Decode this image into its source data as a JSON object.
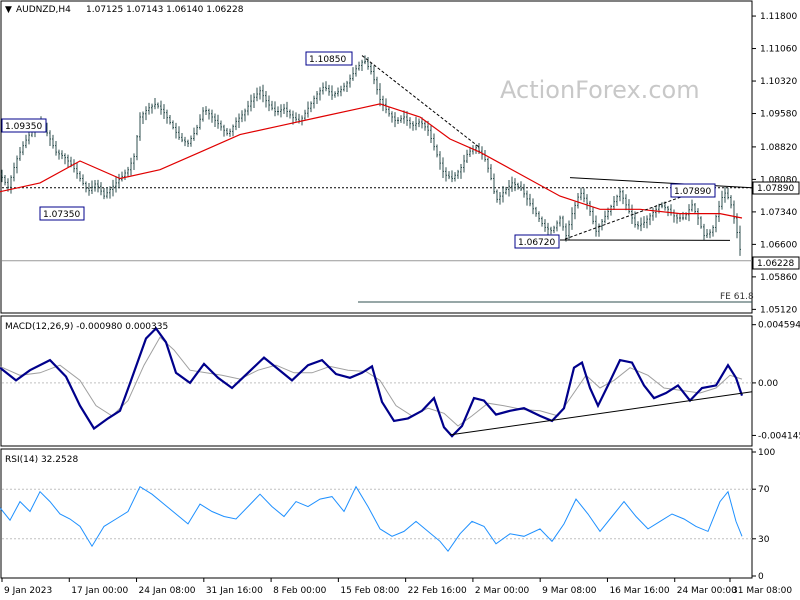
{
  "header": {
    "symbol": "AUDNZD,H4",
    "ohlc": "1.07125 1.07143 1.06140 1.06228"
  },
  "watermark": "ActionForex.com",
  "colors": {
    "candle": "#2f4f4f",
    "ma": "#e00000",
    "macd": "#00008b",
    "signal": "#a0a0a0",
    "rsi": "#1e90ff",
    "trend": "#000000",
    "grid": "#c0c0c0"
  },
  "chart_data": [
    {
      "type": "candlestick",
      "panel": "price",
      "yticks": [
        1.118,
        1.1106,
        1.1032,
        1.0958,
        1.0882,
        1.0808,
        1.0734,
        1.066,
        1.0586,
        1.0512
      ],
      "ylim": [
        1.0506,
        1.1212
      ],
      "current_price": "1.06228",
      "level_label": "1.07890",
      "fib_label": "FE 61.8",
      "annotations": [
        "1.09350",
        "1.07350",
        "1.10850",
        "1.06720",
        "1.07890"
      ],
      "close_path": [
        [
          0,
          1.082
        ],
        [
          8,
          1.079
        ],
        [
          16,
          1.085
        ],
        [
          24,
          1.089
        ],
        [
          32,
          1.092
        ],
        [
          40,
          1.094
        ],
        [
          48,
          1.091
        ],
        [
          56,
          1.087
        ],
        [
          64,
          1.086
        ],
        [
          72,
          1.084
        ],
        [
          80,
          1.081
        ],
        [
          88,
          1.078
        ],
        [
          96,
          1.08
        ],
        [
          104,
          1.077
        ],
        [
          112,
          1.079
        ],
        [
          120,
          1.081
        ],
        [
          128,
          1.083
        ],
        [
          134,
          1.086
        ],
        [
          140,
          1.095
        ],
        [
          148,
          1.097
        ],
        [
          156,
          1.098
        ],
        [
          164,
          1.096
        ],
        [
          172,
          1.093
        ],
        [
          180,
          1.09
        ],
        [
          188,
          1.089
        ],
        [
          196,
          1.092
        ],
        [
          204,
          1.097
        ],
        [
          212,
          1.095
        ],
        [
          220,
          1.093
        ],
        [
          228,
          1.091
        ],
        [
          236,
          1.094
        ],
        [
          244,
          1.096
        ],
        [
          252,
          1.099
        ],
        [
          260,
          1.101
        ],
        [
          268,
          1.098
        ],
        [
          276,
          1.096
        ],
        [
          284,
          1.097
        ],
        [
          292,
          1.095
        ],
        [
          300,
          1.094
        ],
        [
          308,
          1.097
        ],
        [
          316,
          1.1
        ],
        [
          324,
          1.102
        ],
        [
          332,
          1.1
        ],
        [
          340,
          1.101
        ],
        [
          348,
          1.103
        ],
        [
          356,
          1.106
        ],
        [
          364,
          1.108
        ],
        [
          372,
          1.105
        ],
        [
          380,
          1.099
        ],
        [
          388,
          1.096
        ],
        [
          396,
          1.094
        ],
        [
          404,
          1.095
        ],
        [
          412,
          1.093
        ],
        [
          420,
          1.094
        ],
        [
          428,
          1.092
        ],
        [
          436,
          1.087
        ],
        [
          444,
          1.082
        ],
        [
          452,
          1.081
        ],
        [
          460,
          1.083
        ],
        [
          468,
          1.087
        ],
        [
          476,
          1.088
        ],
        [
          484,
          1.086
        ],
        [
          490,
          1.082
        ],
        [
          496,
          1.076
        ],
        [
          504,
          1.078
        ],
        [
          512,
          1.08
        ],
        [
          520,
          1.079
        ],
        [
          528,
          1.076
        ],
        [
          536,
          1.073
        ],
        [
          544,
          1.07
        ],
        [
          552,
          1.069
        ],
        [
          560,
          1.072
        ],
        [
          566,
          1.068
        ],
        [
          572,
          1.073
        ],
        [
          580,
          1.078
        ],
        [
          588,
          1.075
        ],
        [
          596,
          1.069
        ],
        [
          604,
          1.072
        ],
        [
          612,
          1.075
        ],
        [
          620,
          1.078
        ],
        [
          628,
          1.074
        ],
        [
          636,
          1.07
        ],
        [
          644,
          1.071
        ],
        [
          652,
          1.073
        ],
        [
          660,
          1.075
        ],
        [
          668,
          1.074
        ],
        [
          676,
          1.072
        ],
        [
          684,
          1.072
        ],
        [
          692,
          1.075
        ],
        [
          698,
          1.072
        ],
        [
          704,
          1.068
        ],
        [
          712,
          1.069
        ],
        [
          718,
          1.074
        ],
        [
          724,
          1.078
        ],
        [
          730,
          1.076
        ],
        [
          736,
          1.07
        ],
        [
          742,
          1.0623
        ]
      ],
      "ma_path": [
        [
          0,
          1.078
        ],
        [
          40,
          1.08
        ],
        [
          80,
          1.085
        ],
        [
          120,
          1.081
        ],
        [
          160,
          1.083
        ],
        [
          200,
          1.087
        ],
        [
          240,
          1.091
        ],
        [
          280,
          1.093
        ],
        [
          320,
          1.095
        ],
        [
          360,
          1.097
        ],
        [
          380,
          1.098
        ],
        [
          420,
          1.095
        ],
        [
          450,
          1.09
        ],
        [
          480,
          1.087
        ],
        [
          520,
          1.082
        ],
        [
          560,
          1.077
        ],
        [
          600,
          1.074
        ],
        [
          640,
          1.074
        ],
        [
          680,
          1.073
        ],
        [
          720,
          1.073
        ],
        [
          742,
          1.072
        ]
      ]
    },
    {
      "type": "line",
      "panel": "macd",
      "title": "MACD(12,26,9) -0.000980 0.000335",
      "yticks": [
        0.004594,
        0.0,
        -0.004145
      ],
      "ylim": [
        -0.0049,
        0.0052
      ],
      "series": [
        {
          "name": "MACD",
          "points": [
            [
              0,
              0.0012
            ],
            [
              16,
              0.0002
            ],
            [
              30,
              0.001
            ],
            [
              50,
              0.0018
            ],
            [
              66,
              0.0005
            ],
            [
              80,
              -0.0018
            ],
            [
              94,
              -0.0036
            ],
            [
              108,
              -0.0028
            ],
            [
              120,
              -0.0022
            ],
            [
              132,
              0.0004
            ],
            [
              146,
              0.0035
            ],
            [
              156,
              0.0043
            ],
            [
              166,
              0.0032
            ],
            [
              176,
              0.0008
            ],
            [
              190,
              0.0
            ],
            [
              204,
              0.0015
            ],
            [
              218,
              0.0004
            ],
            [
              232,
              -0.0004
            ],
            [
              248,
              0.0008
            ],
            [
              264,
              0.002
            ],
            [
              278,
              0.0011
            ],
            [
              292,
              0.0002
            ],
            [
              308,
              0.0014
            ],
            [
              322,
              0.0018
            ],
            [
              336,
              0.0007
            ],
            [
              350,
              0.0004
            ],
            [
              362,
              0.0008
            ],
            [
              372,
              0.0013
            ],
            [
              382,
              -0.0015
            ],
            [
              394,
              -0.003
            ],
            [
              408,
              -0.0028
            ],
            [
              422,
              -0.0022
            ],
            [
              434,
              -0.0012
            ],
            [
              444,
              -0.0035
            ],
            [
              452,
              -0.0042
            ],
            [
              462,
              -0.0034
            ],
            [
              474,
              -0.0012
            ],
            [
              484,
              -0.0014
            ],
            [
              496,
              -0.0025
            ],
            [
              510,
              -0.0022
            ],
            [
              524,
              -0.002
            ],
            [
              540,
              -0.0026
            ],
            [
              552,
              -0.003
            ],
            [
              564,
              -0.002
            ],
            [
              574,
              0.0012
            ],
            [
              582,
              0.0016
            ],
            [
              590,
              -0.0004
            ],
            [
              598,
              -0.0018
            ],
            [
              608,
              -0.0002
            ],
            [
              620,
              0.0018
            ],
            [
              632,
              0.0016
            ],
            [
              644,
              -0.0002
            ],
            [
              654,
              -0.0012
            ],
            [
              666,
              -0.0008
            ],
            [
              678,
              -0.0002
            ],
            [
              690,
              -0.0014
            ],
            [
              702,
              -0.0004
            ],
            [
              716,
              -0.0002
            ],
            [
              728,
              0.0014
            ],
            [
              736,
              0.0004
            ],
            [
              742,
              -0.001
            ]
          ]
        },
        {
          "name": "Signal",
          "points": [
            [
              0,
              0.0013
            ],
            [
              20,
              0.0006
            ],
            [
              40,
              0.0008
            ],
            [
              60,
              0.0014
            ],
            [
              80,
              0.0002
            ],
            [
              96,
              -0.0018
            ],
            [
              112,
              -0.0026
            ],
            [
              128,
              -0.0014
            ],
            [
              144,
              0.0014
            ],
            [
              160,
              0.0036
            ],
            [
              174,
              0.0026
            ],
            [
              190,
              0.001
            ],
            [
              206,
              0.0008
            ],
            [
              222,
              0.0006
            ],
            [
              240,
              0.0003
            ],
            [
              258,
              0.001
            ],
            [
              276,
              0.0014
            ],
            [
              294,
              0.0008
            ],
            [
              312,
              0.0008
            ],
            [
              330,
              0.0013
            ],
            [
              348,
              0.001
            ],
            [
              366,
              0.0009
            ],
            [
              380,
              0.0002
            ],
            [
              396,
              -0.0018
            ],
            [
              412,
              -0.0026
            ],
            [
              428,
              -0.002
            ],
            [
              444,
              -0.0024
            ],
            [
              458,
              -0.0034
            ],
            [
              472,
              -0.0026
            ],
            [
              488,
              -0.0016
            ],
            [
              504,
              -0.0018
            ],
            [
              522,
              -0.0021
            ],
            [
              540,
              -0.0022
            ],
            [
              558,
              -0.0026
            ],
            [
              572,
              -0.001
            ],
            [
              586,
              0.0006
            ],
            [
              600,
              -0.0004
            ],
            [
              614,
              0.0002
            ],
            [
              630,
              0.0012
            ],
            [
              648,
              0.0006
            ],
            [
              664,
              -0.0004
            ],
            [
              682,
              -0.0006
            ],
            [
              700,
              -0.0008
            ],
            [
              716,
              -0.0004
            ],
            [
              730,
              0.0006
            ],
            [
              742,
              0.0003
            ]
          ]
        }
      ]
    },
    {
      "type": "line",
      "panel": "rsi",
      "title": "RSI(14) 32.2528",
      "yticks": [
        100,
        70,
        30,
        0
      ],
      "ylim": [
        0,
        100
      ],
      "series": [
        {
          "name": "RSI",
          "points": [
            [
              0,
              55
            ],
            [
              10,
              45
            ],
            [
              20,
              60
            ],
            [
              30,
              52
            ],
            [
              40,
              68
            ],
            [
              50,
              60
            ],
            [
              60,
              50
            ],
            [
              70,
              46
            ],
            [
              80,
              40
            ],
            [
              92,
              24
            ],
            [
              104,
              40
            ],
            [
              116,
              46
            ],
            [
              128,
              52
            ],
            [
              140,
              72
            ],
            [
              152,
              66
            ],
            [
              164,
              58
            ],
            [
              176,
              50
            ],
            [
              188,
              42
            ],
            [
              200,
              58
            ],
            [
              212,
              52
            ],
            [
              224,
              48
            ],
            [
              236,
              46
            ],
            [
              248,
              56
            ],
            [
              260,
              66
            ],
            [
              272,
              56
            ],
            [
              284,
              48
            ],
            [
              296,
              60
            ],
            [
              308,
              56
            ],
            [
              320,
              62
            ],
            [
              332,
              64
            ],
            [
              344,
              52
            ],
            [
              356,
              72
            ],
            [
              368,
              56
            ],
            [
              380,
              38
            ],
            [
              392,
              32
            ],
            [
              404,
              36
            ],
            [
              416,
              44
            ],
            [
              428,
              36
            ],
            [
              440,
              28
            ],
            [
              448,
              20
            ],
            [
              460,
              34
            ],
            [
              472,
              44
            ],
            [
              484,
              40
            ],
            [
              496,
              26
            ],
            [
              510,
              34
            ],
            [
              524,
              32
            ],
            [
              540,
              38
            ],
            [
              552,
              28
            ],
            [
              564,
              42
            ],
            [
              576,
              62
            ],
            [
              588,
              50
            ],
            [
              600,
              36
            ],
            [
              612,
              48
            ],
            [
              624,
              60
            ],
            [
              636,
              48
            ],
            [
              648,
              38
            ],
            [
              660,
              44
            ],
            [
              672,
              50
            ],
            [
              684,
              46
            ],
            [
              696,
              40
            ],
            [
              708,
              36
            ],
            [
              720,
              60
            ],
            [
              728,
              68
            ],
            [
              736,
              44
            ],
            [
              742,
              32
            ]
          ]
        }
      ]
    }
  ],
  "xaxis": {
    "labels": [
      "9 Jan 2023",
      "17 Jan 00:00",
      "24 Jan 08:00",
      "31 Jan 16:00",
      "8 Feb 00:00",
      "15 Feb 08:00",
      "22 Feb 16:00",
      "2 Mar 00:00",
      "9 Mar 08:00",
      "16 Mar 16:00",
      "24 Mar 00:00",
      "31 Mar 08:00"
    ]
  }
}
